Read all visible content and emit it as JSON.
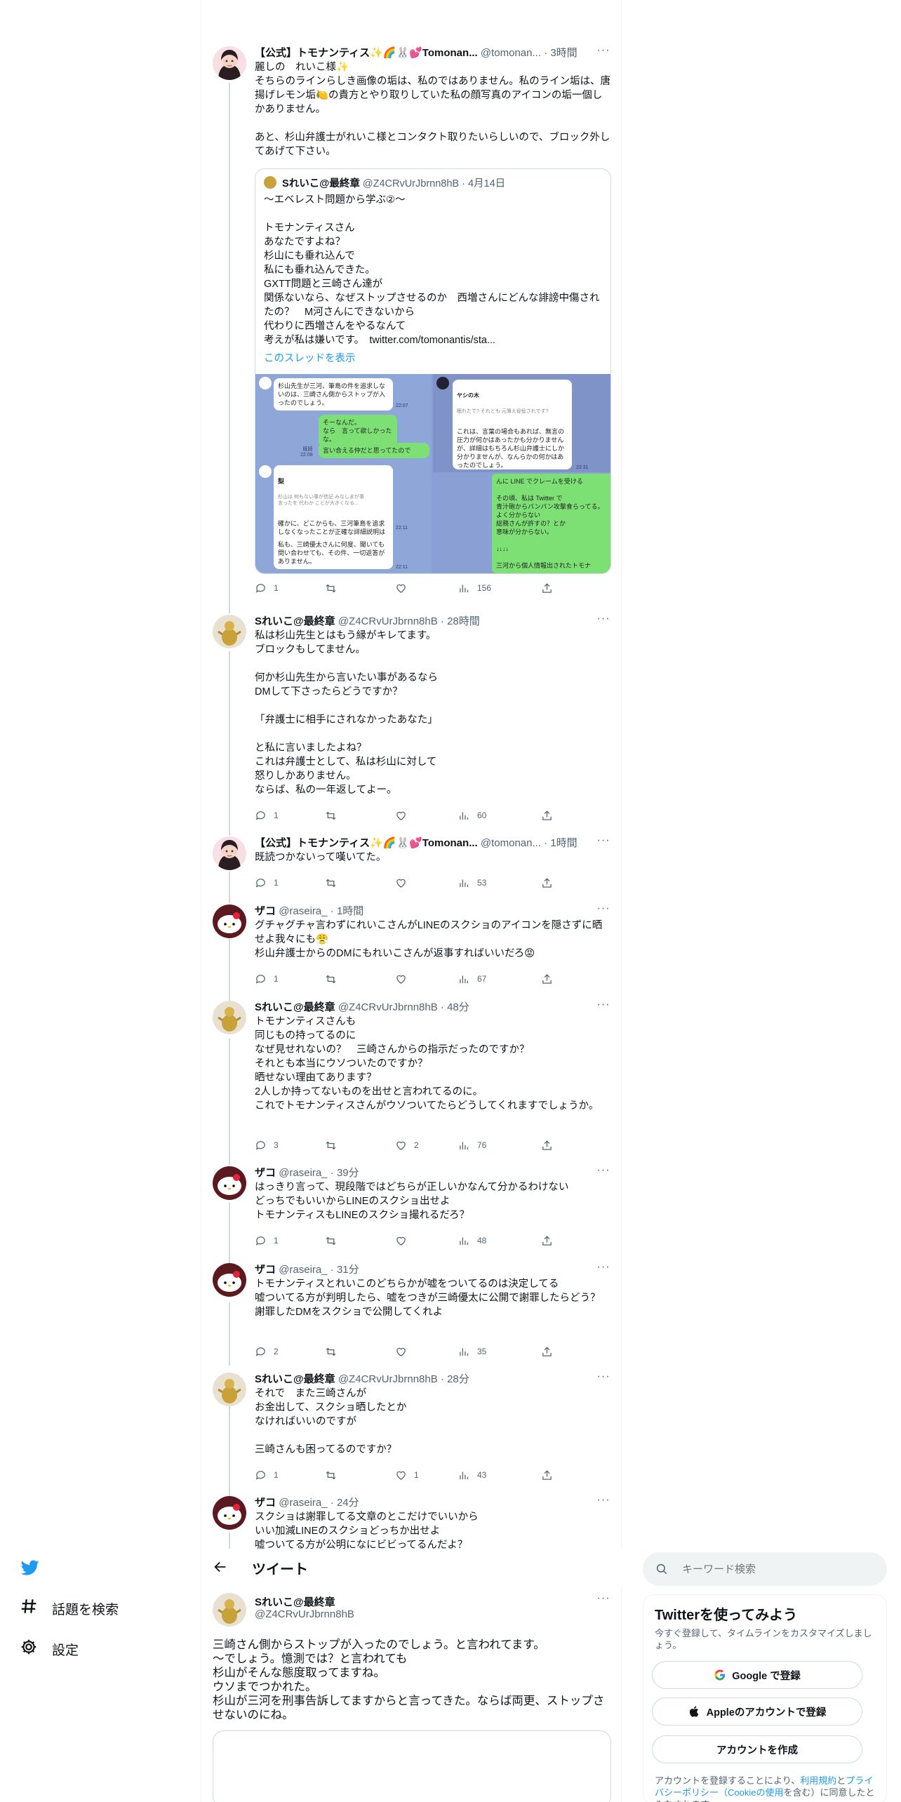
{
  "nav": {
    "explore": "話題を検索",
    "settings": "設定"
  },
  "search": {
    "placeholder": "キーワード検索"
  },
  "signup": {
    "title": "Twitterを使ってみよう",
    "subtitle": "今すぐ登録して、タイムラインをカスタマイズしましょう。",
    "google": "Google で登録",
    "apple": "Appleのアカウントで登録",
    "create": "アカウントを作成",
    "legal_prefix": "アカウントを登録することにより、",
    "legal_terms": "利用規約",
    "legal_and": "と",
    "legal_privacy": "プライバシーポリシー（Cookieの使用",
    "legal_suffix": "を含む）に同意したとみなされます。"
  },
  "header": {
    "title": "ツイート"
  },
  "thread": [
    {
      "name": "【公式】トモナンティス✨🌈🐰💕Tomonan...",
      "handle": "@tomonan...",
      "time": "· 3時間",
      "text": "麗しの　れいこ様✨\nそちらのラインらしき画像の垢は、私のではありません。私のライン垢は、唐揚げレモン垢🍋の貴方とやり取りしていた私の顔写真のアイコンの垢一個しかありません。\n\nあと、杉山弁護士がれいこ様とコンタクト取りたいらしいので、ブロック外してあげて下さい。",
      "reply": "1",
      "retweet": "",
      "like": "",
      "views": "156",
      "quote": {
        "name": "Sれいこ@最終章",
        "handle": "@Z4CRvUrJbrnn8hB",
        "time": "· 4月14日",
        "text": "〜エベレスト問題から学ぶ②〜\n\nトモナンティスさん\nあなたですよね？\n杉山にも垂れ込んで\n私にも垂れ込んできた。\nGXTT問題と三崎さん達が\n関係ないなら、なぜストップさせるのか　西増さんにどんな誹謗中傷されたの？　M河さんにできないから\n代わりに西増さんをやるなんて\n考えが私は嫌いです。　twitter.com/tomonantis/sta...",
        "show_thread": "このスレッドを表示",
        "img1": {
          "b1": "杉山先生が三河、筆島の件を追求しないのは、三崎さん側からストップが入ったのでしょう。",
          "t1": "22:07",
          "g1": "そーなんだ。\nなら　言って欲しかったな。",
          "t2": "既読\n22:09",
          "g2": "言い合える仲だと思ってたので",
          "b2name": "梨",
          "b2sub": "杉山は 何もない事が信記 みなしまが事\n言ったを 代わか ことが大きくなる...",
          "b2": "確かに、どこからも、三河筆島を追求しなくなったことが正確な詳細説明は有りませんでしたね。",
          "t3": "22:11",
          "b3": "私も、三崎優太さんに何度、聞いても問い合わせても、その件、一切返答がありません。",
          "t4": "22:11"
        },
        "img2": {
          "name": "ヤシの木",
          "sub": "眠れたで? それとも 元簿え役役されです?",
          "b1": "これは、言葉の場合もあれば、無言の圧力が何かはあったかも分かりませんが、詳細はもちろん杉山弁護士にしか分かりませんが、なんらかの何かはあったのでしょう。",
          "t1": "22:31"
        },
        "img3": {
          "g1": "んに LINE でクレームを受ける\n\nその頃、私は Twitter で\n青汁砲からバンバン攻撃食らってる。よく分からない\n総務さんが許すの？とか\n意味が分からない。\n\n↓↓↓↓\n\n三河から個人情報出されたトモナ"
        }
      }
    },
    {
      "name": "Sれいこ@最終章",
      "handle": "@Z4CRvUrJbrnn8hB",
      "time": "· 28時間",
      "text": "私は杉山先生とはもう縁がキレてます。\nブロックもしてません。\n\n何か杉山先生から言いたい事があるなら\nDMして下さったらどうですか？\n\n「弁護士に相手にされなかったあなた」\n\nと私に言いましたよね？\nこれは弁護士として、私は杉山に対して\n怒りしかありません。\nならば、私の一年返してよー。",
      "reply": "1",
      "retweet": "",
      "like": "",
      "views": "60"
    },
    {
      "name": "【公式】トモナンティス✨🌈🐰💕Tomonan...",
      "handle": "@tomonan...",
      "time": "· 1時間",
      "text": "既読つかないって嘆いてた。",
      "reply": "1",
      "retweet": "",
      "like": "",
      "views": "53"
    },
    {
      "name": "ザコ",
      "handle": "@raseira_",
      "time": "· 1時間",
      "text": "グチャグチャ言わずにれいこさんがLINEのスクショのアイコンを隠さずに晒せよ我々にも😤\n杉山弁護士からのDMにもれいこさんが返事すればいいだろ😡",
      "reply": "1",
      "retweet": "",
      "like": "",
      "views": "67"
    },
    {
      "name": "Sれいこ@最終章",
      "handle": "@Z4CRvUrJbrnn8hB",
      "time": "· 48分",
      "text": "トモナンティスさんも\n同じもの持ってるのに\nなぜ見せれないの？　三崎さんからの指示だったのですか？\nそれとも本当にウソついたのですか？\n晒せない理由てあります？\n2人しか持ってないものを出せと言われてるのに。\nこれでトモナンティスさんがウソついてたらどうしてくれますでしょうか。",
      "reply": "3",
      "retweet": "",
      "like": "2",
      "views": "76"
    },
    {
      "name": "ザコ",
      "handle": "@raseira_",
      "time": "· 39分",
      "text": "はっきり言って、現段階ではどちらが正しいかなんて分かるわけない\nどっちでもいいからLINEのスクショ出せよ\nトモナンティスもLINEのスクショ撮れるだろ？",
      "reply": "1",
      "retweet": "",
      "like": "",
      "views": "48"
    },
    {
      "name": "ザコ",
      "handle": "@raseira_",
      "time": "· 31分",
      "text": "トモナンティスとれいこのどちらかが嘘をついてるのは決定してる\n嘘ついてる方が判明したら、嘘をつきが三崎優太に公開で謝罪したらどう？\n謝罪したDMをスクショで公開してくれよ",
      "reply": "2",
      "retweet": "",
      "like": "",
      "views": "35"
    },
    {
      "name": "Sれいこ@最終章",
      "handle": "@Z4CRvUrJbrnn8hB",
      "time": "· 28分",
      "text": "それで　また三崎さんが\nお金出して、スクショ晒したとか\nなければいいのですが\n\n三崎さんも困ってるのですか？",
      "reply": "1",
      "retweet": "",
      "like": "1",
      "views": "43"
    },
    {
      "name": "ザコ",
      "handle": "@raseira_",
      "time": "· 24分",
      "text": "スクショは謝罪してる文章のとこだけでいいから\nいい加減LINEのスクショどっちか出せよ\n嘘ついてる方が公明になにビビってるんだよ？"
    }
  ],
  "main": {
    "name": "Sれいこ@最終章",
    "handle": "@Z4CRvUrJbrnn8hB",
    "text": "三崎さん側からストップが入ったのでしょう。と言われてます。\n〜でしょう。憶測では？と言われても\n杉山がそんな態度取ってますね。\nウソまでつかれた。\n杉山が三河を刑事告訴してますからと言ってきた。ならば両更、ストップさせないのにね。"
  },
  "colors": {
    "accent": "#1d9bf0",
    "text": "#0f1419",
    "secondary": "#536471",
    "border": "#cfd9de",
    "line_green": "#7de075"
  },
  "icons": [
    "twitter-bird-icon",
    "hashtag-icon",
    "gear-icon",
    "back-arrow-icon",
    "search-icon",
    "reply-icon",
    "retweet-icon",
    "like-icon",
    "views-icon",
    "share-icon",
    "more-icon",
    "google-icon",
    "apple-icon"
  ]
}
